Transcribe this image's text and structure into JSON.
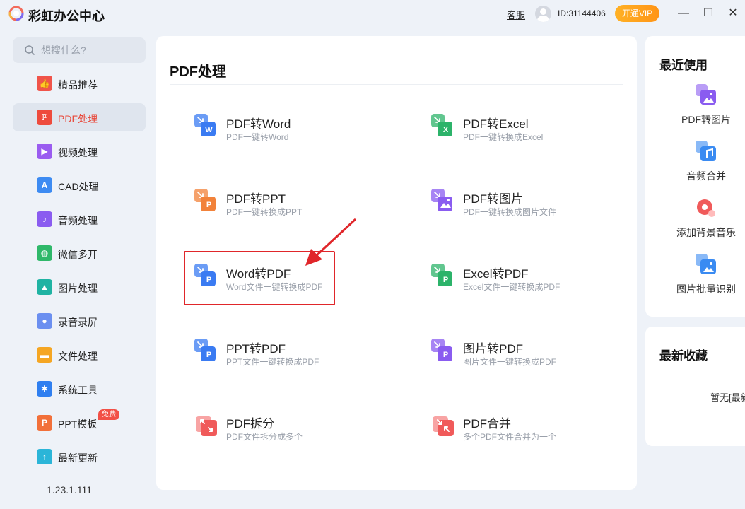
{
  "app": {
    "title": "彩虹办公中心",
    "service_link": "客服",
    "user_id": "ID:31144406",
    "vip_button": "开通VIP",
    "minimize": "—",
    "maximize": "☐",
    "close": "✕"
  },
  "search": {
    "placeholder": "想搜什么?"
  },
  "sidebar": {
    "items": [
      {
        "label": "精品推荐",
        "icon": "thumbs-up-icon",
        "color": "#f0544a"
      },
      {
        "label": "PDF处理",
        "icon": "pdf-icon",
        "color": "#ee4b3d"
      },
      {
        "label": "视频处理",
        "icon": "video-play-icon",
        "color": "#9a5cf0"
      },
      {
        "label": "CAD处理",
        "icon": "cad-icon",
        "color": "#3d8bf2"
      },
      {
        "label": "音频处理",
        "icon": "music-note-icon",
        "color": "#8a5cf0"
      },
      {
        "label": "微信多开",
        "icon": "wechat-icon",
        "color": "#2fb86a"
      },
      {
        "label": "图片处理",
        "icon": "image-icon",
        "color": "#1fb3a3"
      },
      {
        "label": "录音录屏",
        "icon": "microphone-icon",
        "color": "#6b8ff0"
      },
      {
        "label": "文件处理",
        "icon": "folder-icon",
        "color": "#f5a623"
      },
      {
        "label": "系统工具",
        "icon": "gear-icon",
        "color": "#2f7ff0"
      },
      {
        "label": "PPT模板",
        "icon": "ppt-icon",
        "color": "#f2703a",
        "badge": "免费"
      },
      {
        "label": "最新更新",
        "icon": "upload-icon",
        "color": "#2bb5d8"
      }
    ],
    "version": "1.23.1.111"
  },
  "main": {
    "title": "PDF处理",
    "tools": [
      {
        "name": "PDF转Word",
        "desc": "PDF一键转Word",
        "icon": "pdf-to-word-icon",
        "letter": "W",
        "color": "#3a7bf2"
      },
      {
        "name": "PDF转Excel",
        "desc": "PDF一键转换成Excel",
        "icon": "pdf-to-excel-icon",
        "letter": "X",
        "color": "#2cb36a"
      },
      {
        "name": "PDF转PPT",
        "desc": "PDF一键转换成PPT",
        "icon": "pdf-to-ppt-icon",
        "letter": "P",
        "color": "#f2823a"
      },
      {
        "name": "PDF转图片",
        "desc": "PDF一键转换成图片文件",
        "icon": "pdf-to-image-icon",
        "letter": "",
        "color": "#8a5cf0"
      },
      {
        "name": "Word转PDF",
        "desc": "Word文件一键转换成PDF",
        "icon": "word-to-pdf-icon",
        "letter": "P",
        "color": "#3a7bf2"
      },
      {
        "name": "Excel转PDF",
        "desc": "Excel文件一键转换成PDF",
        "icon": "excel-to-pdf-icon",
        "letter": "P",
        "color": "#2cb36a"
      },
      {
        "name": "PPT转PDF",
        "desc": "PPT文件一键转换成PDF",
        "icon": "ppt-to-pdf-icon",
        "letter": "P",
        "color": "#3a7bf2"
      },
      {
        "name": "图片转PDF",
        "desc": "图片文件一键转换成PDF",
        "icon": "image-to-pdf-icon",
        "letter": "P",
        "color": "#8a5cf0"
      },
      {
        "name": "PDF拆分",
        "desc": "PDF文件拆分成多个",
        "icon": "pdf-split-icon",
        "letter": "",
        "color": "#f05a5a"
      },
      {
        "name": "PDF合并",
        "desc": "多个PDF文件合并为一个",
        "icon": "pdf-merge-icon",
        "letter": "",
        "color": "#f05a5a"
      }
    ]
  },
  "recent": {
    "title": "最近使用",
    "items": [
      {
        "label": "PDF转图片",
        "icon": "pdf-to-image-icon",
        "color": "#8a5cf0"
      },
      {
        "label": "音频合并",
        "icon": "audio-merge-icon",
        "color": "#3a8bf2"
      },
      {
        "label": "添加背景音乐",
        "icon": "background-music-icon",
        "color": "#f05a5a"
      },
      {
        "label": "图片批量识别",
        "icon": "image-recognition-icon",
        "color": "#3a8bf2"
      }
    ]
  },
  "favorites": {
    "title": "最新收藏",
    "empty_text": "暂无[最新收藏]"
  }
}
